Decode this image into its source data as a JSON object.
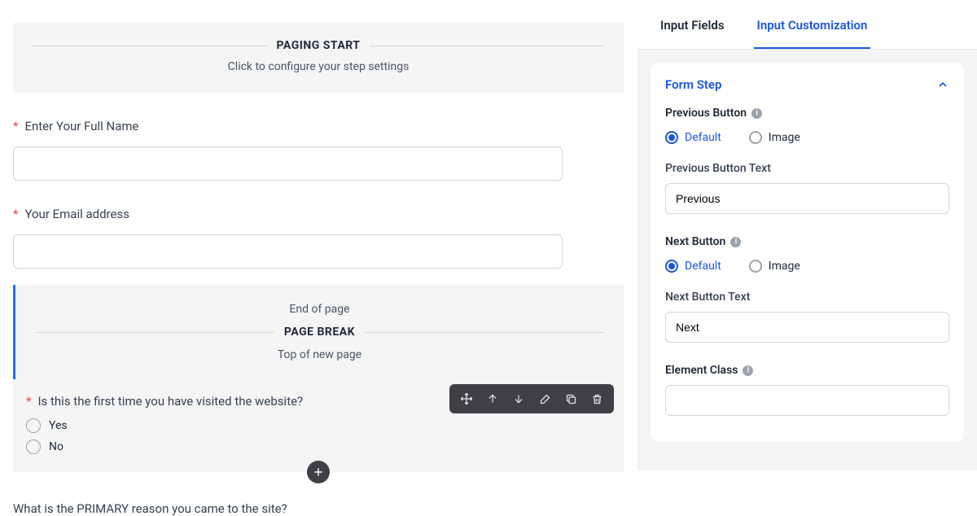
{
  "paging_start": {
    "title": "PAGING START",
    "subtitle": "Click to configure your step settings"
  },
  "field_name": {
    "label": "Enter Your Full Name"
  },
  "field_email": {
    "label": "Your Email address"
  },
  "page_break": {
    "end": "End of page",
    "label": "PAGE BREAK",
    "top": "Top of new page"
  },
  "question_visit": {
    "label": "Is this the first time you have visited the website?",
    "opt_yes": "Yes",
    "opt_no": "No"
  },
  "next_question": "What is the PRIMARY reason you came to the site?",
  "tabs": {
    "input_fields": "Input Fields",
    "input_customization": "Input Customization"
  },
  "panel": {
    "title": "Form Step",
    "prev_button_label": "Previous Button",
    "radio_default": "Default",
    "radio_image": "Image",
    "prev_text_label": "Previous Button Text",
    "prev_text_value": "Previous",
    "next_button_label": "Next Button",
    "next_text_label": "Next Button Text",
    "next_text_value": "Next",
    "element_class_label": "Element Class"
  }
}
